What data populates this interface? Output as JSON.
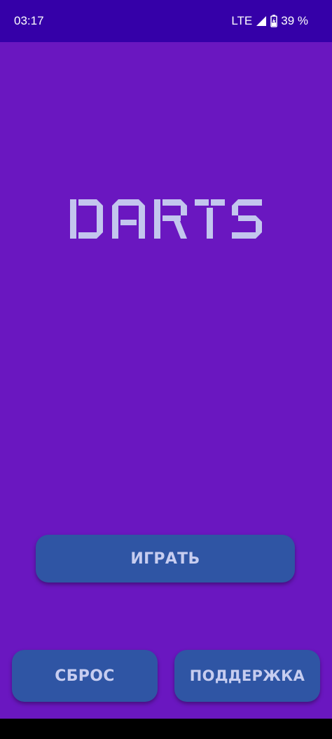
{
  "status_bar": {
    "time": "03:17",
    "network": "LTE",
    "battery": "39 %",
    "icons": [
      "signal-icon",
      "battery-charging-icon"
    ]
  },
  "logo": {
    "text": "DARTS",
    "color": "#c3c6ee"
  },
  "buttons": {
    "play": "ИГРАТЬ",
    "reset": "СБРОС",
    "support": "ПОДДЕРЖКА"
  },
  "colors": {
    "background": "#6a17c0",
    "status_bar": "#3500a8",
    "button": "#2f55a4",
    "button_text": "#c7cdf0"
  }
}
